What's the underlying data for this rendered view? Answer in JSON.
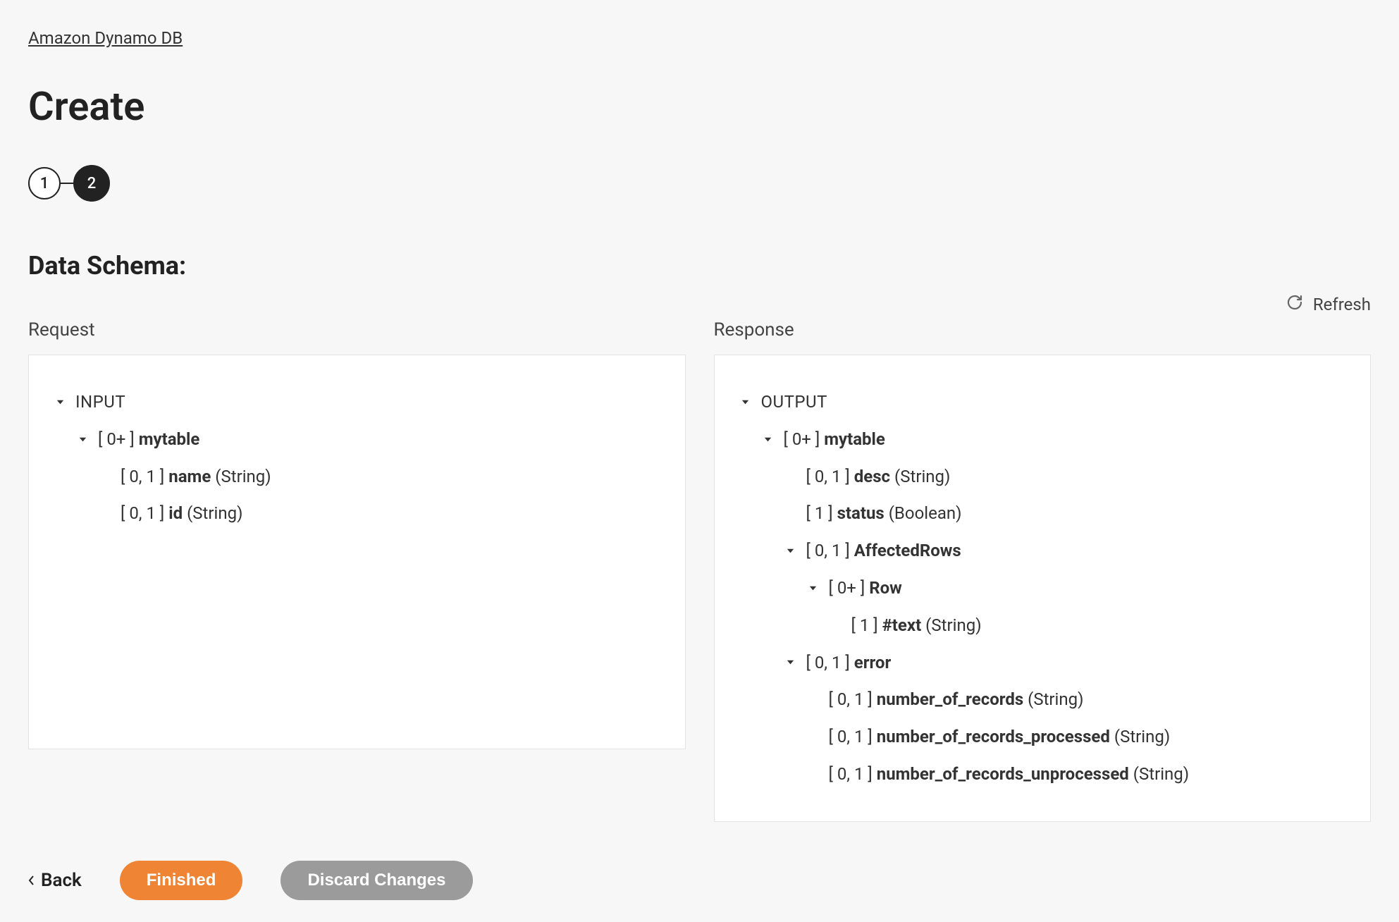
{
  "breadcrumb": "Amazon Dynamo DB",
  "page_title": "Create",
  "stepper": {
    "step1": "1",
    "step2": "2",
    "active_index": 2
  },
  "section_heading": "Data Schema:",
  "refresh_label": "Refresh",
  "request": {
    "label": "Request",
    "root": "INPUT",
    "items": [
      {
        "depth": 1,
        "chevron": true,
        "occ": "[ 0+ ]",
        "name": "mytable",
        "type": ""
      },
      {
        "depth": 2,
        "chevron": false,
        "occ": "[ 0, 1 ]",
        "name": "name",
        "type": "(String)"
      },
      {
        "depth": 2,
        "chevron": false,
        "occ": "[ 0, 1 ]",
        "name": "id",
        "type": "(String)"
      }
    ]
  },
  "response": {
    "label": "Response",
    "root": "OUTPUT",
    "items": [
      {
        "depth": 1,
        "chevron": true,
        "occ": "[ 0+ ]",
        "name": "mytable",
        "type": ""
      },
      {
        "depth": 2,
        "chevron": false,
        "occ": "[ 0, 1 ]",
        "name": "desc",
        "type": "(String)"
      },
      {
        "depth": 2,
        "chevron": false,
        "occ": "[ 1 ]",
        "name": "status",
        "type": "(Boolean)"
      },
      {
        "depth": 2,
        "chevron": true,
        "occ": "[ 0, 1 ]",
        "name": "AffectedRows",
        "type": ""
      },
      {
        "depth": 3,
        "chevron": true,
        "occ": "[ 0+ ]",
        "name": "Row",
        "type": ""
      },
      {
        "depth": 4,
        "chevron": false,
        "occ": "[ 1 ]",
        "name": "#text",
        "type": "(String)"
      },
      {
        "depth": 2,
        "chevron": true,
        "occ": "[ 0, 1 ]",
        "name": "error",
        "type": ""
      },
      {
        "depth": 3,
        "chevron": false,
        "occ": "[ 0, 1 ]",
        "name": "number_of_records",
        "type": "(String)"
      },
      {
        "depth": 3,
        "chevron": false,
        "occ": "[ 0, 1 ]",
        "name": "number_of_records_processed",
        "type": "(String)"
      },
      {
        "depth": 3,
        "chevron": false,
        "occ": "[ 0, 1 ]",
        "name": "number_of_records_unprocessed",
        "type": "(String)"
      }
    ]
  },
  "footer": {
    "back": "Back",
    "finished": "Finished",
    "discard": "Discard Changes"
  }
}
